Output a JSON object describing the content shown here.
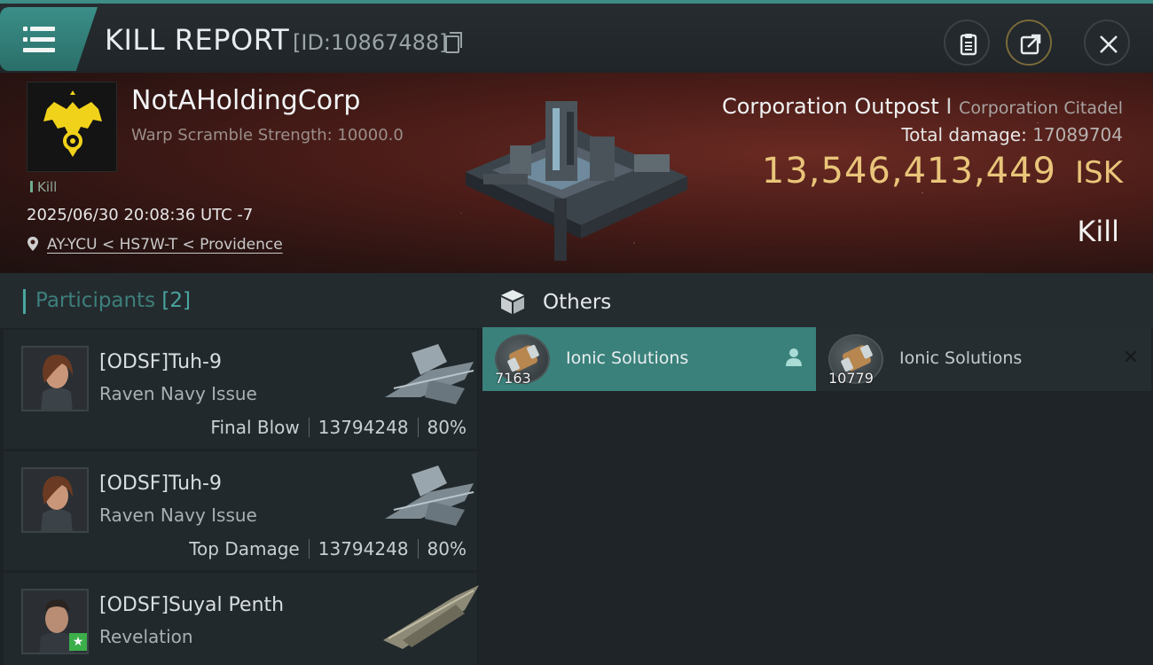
{
  "header": {
    "title": "KILL REPORT",
    "id_label": "[ID:10867488]"
  },
  "victim": {
    "corp_name": "NotAHoldingCorp",
    "warp_scramble": "Warp Scramble Strength: 10000.0",
    "kill_tag": "Kill",
    "datetime": "2025/06/30 20:08:36 UTC -7",
    "location": "AY-YCU < HS7W-T < Providence",
    "structure_type": "Corporation Outpost",
    "structure_class": "Corporation Citadel",
    "total_damage_label": "Total damage:",
    "total_damage_value": "17089704",
    "isk_value": "13,546,413,449",
    "isk_unit": "ISK",
    "result": "Kill"
  },
  "participants": {
    "title": "Participants",
    "count": "[2]",
    "rows": [
      {
        "name": "[ODSF]Tuh-9",
        "ship": "Raven Navy Issue",
        "role": "Final Blow",
        "damage": "13794248",
        "percent": "80%"
      },
      {
        "name": "[ODSF]Tuh-9",
        "ship": "Raven Navy Issue",
        "role": "Top Damage",
        "damage": "13794248",
        "percent": "80%"
      },
      {
        "name": "[ODSF]Suyal Penth",
        "ship": "Revelation"
      }
    ]
  },
  "others": {
    "title": "Others",
    "items": [
      {
        "name": "Ionic Solutions",
        "qty": "7163"
      },
      {
        "name": "Ionic Solutions",
        "qty": "10779"
      }
    ]
  },
  "colors": {
    "accent": "#3d8c86",
    "isk_gold": "#e9c57a",
    "selected_item": "#3a817b"
  }
}
